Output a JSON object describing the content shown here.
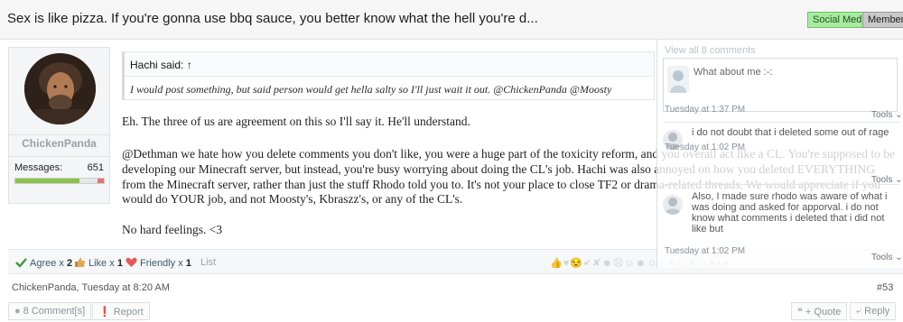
{
  "thread": {
    "title": "Sex is like pizza. If you're gonna use bbq sauce, you better know what the hell you're d...",
    "prefixes": [
      "Social Media",
      "Member"
    ]
  },
  "user": {
    "name": "ChickenPanda",
    "messages_label": "Messages:",
    "messages_value": "651",
    "rating_positive_fraction": 0.72
  },
  "quote": {
    "header": "Hachi said: ↑",
    "body": "I would post something, but said person would get hella salty so I'll just wait it out. @ChickenPanda @Moosty"
  },
  "message": {
    "lines": [
      "Eh. The three of us are agreement on this so I'll say it. He'll understand.",
      "@Dethman we hate how you delete comments you don't like, you were a huge part of the toxicity reform, and you overall act like a CL. You're supposed to be",
      "developing our Minecraft server, but instead, you're busy worrying about doing the CL's job. Hachi was also annoyed on how you deleted EVERYTHING",
      "from the Minecraft server, rather than just the stuff Rhodo told you to. It's not your place to close TF2 or drama-related threads. We would appreciate if you",
      "would do YOUR job, and not Moosty's, Kbraszz's, or any of the CL's.",
      "No hard feelings. <3"
    ]
  },
  "ratings": {
    "agree_label": "Agree x",
    "agree_count": "2",
    "like_label": "Like x",
    "like_count": "1",
    "friendly_label": "Friendly x",
    "friendly_count": "1",
    "list_label": "List"
  },
  "meta": {
    "author_date": "ChickenPanda, Tuesday at 8:20 AM",
    "post_number": "#53"
  },
  "actions": {
    "comments": "8 Comment[s]",
    "report": "Report",
    "quote": "+ Quote",
    "reply": "Reply"
  },
  "comments": {
    "view_all": "View all 8 comments",
    "input_placeholder": "What about me :-:",
    "items": [
      {
        "time": "Tuesday at 1:37 PM",
        "tools": "Tools",
        "text": "i do not doubt that i deleted some out of rage"
      },
      {
        "time": "Tuesday at 1:02 PM",
        "tools": "Tools",
        "text": "Also, I made sure rhodo was aware of what i was doing and asked for apporval. i do not know what comments i deleted that i did not like but"
      },
      {
        "time": "Tuesday at 1:02 PM",
        "tools": "Tools"
      }
    ]
  },
  "colors": {
    "social_media_prefix": "#a7eba1",
    "member_prefix": "#c9c9c9",
    "positive_bar": "#8bc34a",
    "negative_bar": "#e57373"
  }
}
